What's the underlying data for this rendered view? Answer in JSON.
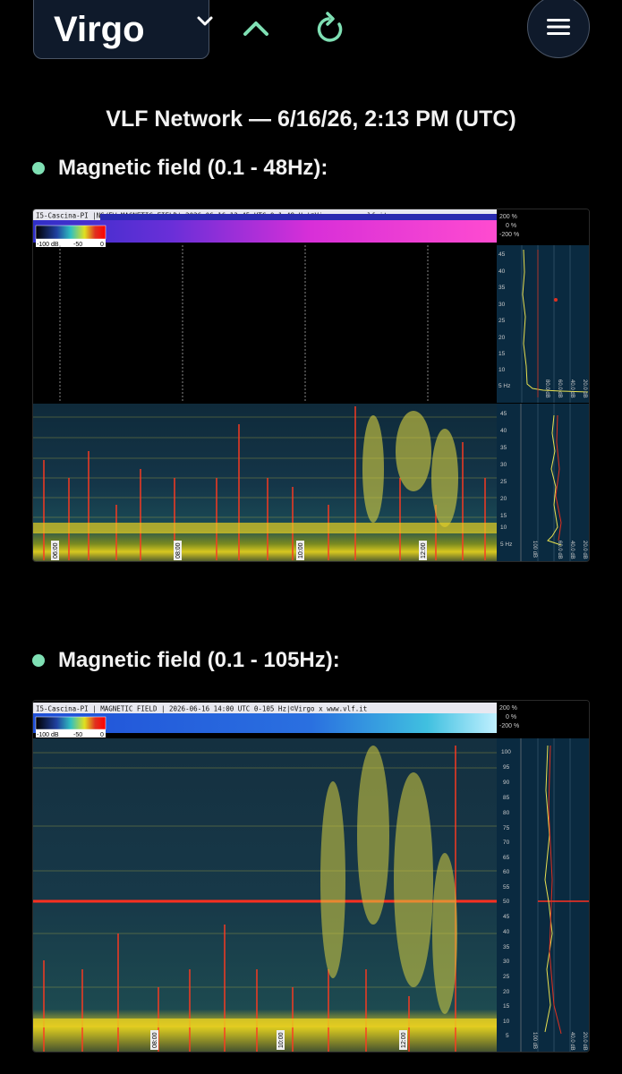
{
  "station": {
    "name": "Virgo"
  },
  "header": {
    "title": "VLF Network — 6/16/26, 2:13 PM (UTC)"
  },
  "colors": {
    "accent": "#7fe0b4",
    "button_bg": "#0f1a2b",
    "icon_green": "#7fe0b4"
  },
  "icons": {
    "dropdown": "chevron-down-icon",
    "up": "chevron-up-icon",
    "reload": "reload-icon",
    "menu": "hamburger-menu-icon"
  },
  "sections": [
    {
      "label": "Magnetic field (0.1 - 48Hz):",
      "banner": "I5-Cascina-PI |NS/EW-MAGNETIC FIELD| 2026-06-16 13:45 UTC 0.1-48 Hz|©Virgo x www.vlf.it",
      "scale_labels": [
        "-100 dB",
        "-50",
        "0"
      ],
      "pct_labels": [
        "200 %",
        "0 %",
        "-200 %"
      ],
      "freq_ticks_top": [
        "45",
        "40",
        "35",
        "30",
        "25",
        "20",
        "15",
        "10",
        "5 Hz"
      ],
      "freq_ticks_bottom": [
        "45",
        "40",
        "35",
        "30",
        "25",
        "20",
        "15",
        "10",
        "5 Hz"
      ],
      "time_labels": [
        "06:00",
        "08:00",
        "10:00",
        "12:00"
      ],
      "db_labels": [
        "80.0 dB",
        "60.0 dB",
        "40.0 dB",
        "20.0 dB"
      ],
      "db_labels_bottom": [
        "100 dB",
        "60.0 dB",
        "40.0 dB",
        "20.0 dB"
      ]
    },
    {
      "label": "Magnetic field (0.1 - 105Hz):",
      "banner": "I5-Cascina-PI | MAGNETIC FIELD | 2026-06-16 14:00 UTC 0-105 Hz|©Virgo x www.vlf.it",
      "scale_labels": [
        "-100 dB",
        "-50",
        "0"
      ],
      "pct_labels": [
        "200 %",
        "0 %",
        "-200 %"
      ],
      "freq_ticks": [
        "100",
        "95",
        "90",
        "85",
        "80",
        "75",
        "70",
        "65",
        "60",
        "55",
        "50",
        "45",
        "40",
        "35",
        "30",
        "25",
        "20",
        "15",
        "10",
        "5"
      ],
      "time_labels": [
        "08:00",
        "10:00",
        "12:00"
      ],
      "db_labels": [
        "100 dB",
        "40.0 dB",
        "20.0 dB"
      ]
    }
  ]
}
